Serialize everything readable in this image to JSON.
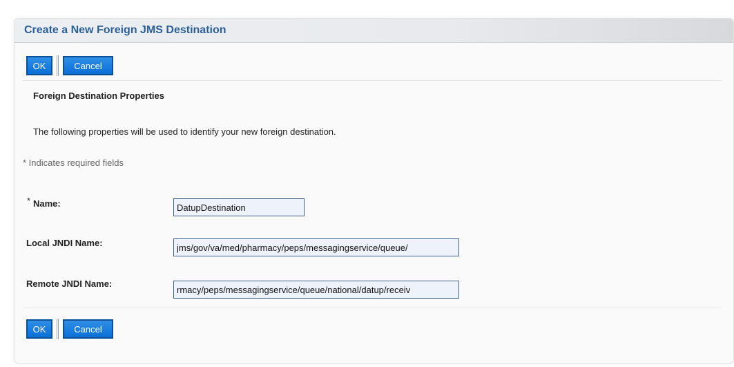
{
  "window": {
    "title": "Create a New Foreign JMS Destination"
  },
  "buttons": {
    "ok": "OK",
    "cancel": "Cancel"
  },
  "section": {
    "heading": "Foreign Destination Properties",
    "description": "The following properties will be used to identify your new foreign destination.",
    "required_note": "* Indicates required fields"
  },
  "fields": {
    "name": {
      "asterisk": "*",
      "label": "Name:",
      "value": "DatupDestination"
    },
    "local_jndi": {
      "label": "Local JNDI Name:",
      "value": "jms/gov/va/med/pharmacy/peps/messagingservice/queue/"
    },
    "remote_jndi": {
      "label": "Remote JNDI Name:",
      "value": "rmacy/peps/messagingservice/queue/national/datup/receiv"
    }
  },
  "colors": {
    "title": "#2a5f98",
    "button": "#0a6fd6",
    "button_border": "#0c4f95"
  }
}
